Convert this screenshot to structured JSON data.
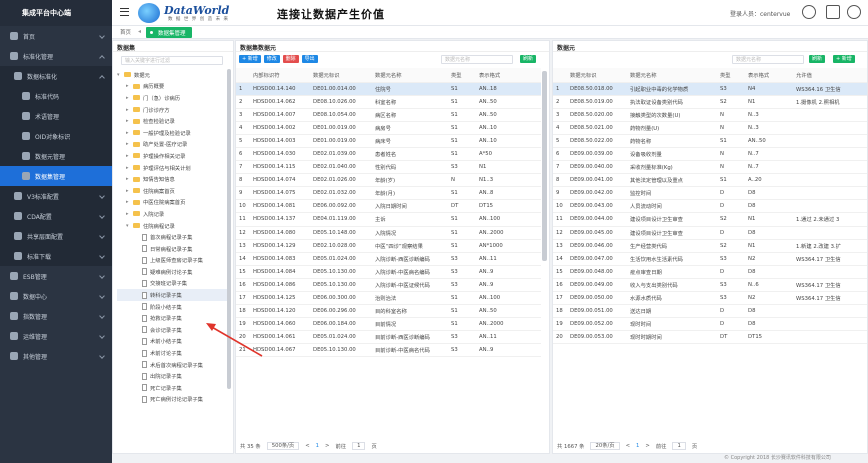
{
  "app": {
    "title": "集成平台中心端"
  },
  "sidebar": {
    "items": [
      {
        "label": "首页",
        "level": 0
      },
      {
        "label": "标准化管理",
        "level": 0,
        "open": true
      },
      {
        "label": "数据标准化",
        "level": 1,
        "open": true
      },
      {
        "label": "标准代码",
        "level": 2
      },
      {
        "label": "术语管理",
        "level": 2
      },
      {
        "label": "OID对象标识",
        "level": 2
      },
      {
        "label": "数据元管理",
        "level": 2
      },
      {
        "label": "数据集管理",
        "level": 2,
        "active": true
      },
      {
        "label": "V3标准配置",
        "level": 1
      },
      {
        "label": "CDA配置",
        "level": 1
      },
      {
        "label": "共享层面配置",
        "level": 1
      },
      {
        "label": "标准下载",
        "level": 1
      },
      {
        "label": "ESB管理",
        "level": 0
      },
      {
        "label": "数据中心",
        "level": 0
      },
      {
        "label": "指数管理",
        "level": 0
      },
      {
        "label": "运维管理",
        "level": 0
      },
      {
        "label": "其他管理",
        "level": 0
      }
    ]
  },
  "topbar": {
    "brand": "DataWorld",
    "brand_sub": "数 据 世 界 创 造 未 来",
    "slogan": "连接让数据产生价值",
    "login_text": "登录人员：centervue"
  },
  "tabs": {
    "home": "首页",
    "active": "数据集管理"
  },
  "tree": {
    "title": "数据集",
    "search_placeholder": "输入关键字进行过滤",
    "nodes": [
      {
        "label": "数据元",
        "type": "folder",
        "level": 0,
        "open": true
      },
      {
        "label": "病历概要",
        "type": "folder",
        "level": 1
      },
      {
        "label": "门（急）诊病历",
        "type": "folder",
        "level": 1
      },
      {
        "label": "门诊诊疗方",
        "type": "folder",
        "level": 1
      },
      {
        "label": "检查检验记录",
        "type": "folder",
        "level": 1
      },
      {
        "label": "一般护理及检验记录",
        "type": "folder",
        "level": 1
      },
      {
        "label": "助产处置-医疗记录",
        "type": "folder",
        "level": 1
      },
      {
        "label": "护理操作相关记录",
        "type": "folder",
        "level": 1
      },
      {
        "label": "护理评估与相关计划",
        "type": "folder",
        "level": 1
      },
      {
        "label": "知情告知信息",
        "type": "folder",
        "level": 1
      },
      {
        "label": "住院病案首页",
        "type": "folder",
        "level": 1
      },
      {
        "label": "中医住院病案首页",
        "type": "folder",
        "level": 1
      },
      {
        "label": "入院记录",
        "type": "folder",
        "level": 1
      },
      {
        "label": "住院病程记录",
        "type": "folder",
        "level": 1,
        "open": true
      },
      {
        "label": "首次病程记录子集",
        "type": "file",
        "level": 2
      },
      {
        "label": "日常病程记录子集",
        "type": "file",
        "level": 2
      },
      {
        "label": "上级医师查房记录子集",
        "type": "file",
        "level": 2
      },
      {
        "label": "疑难病例讨论子集",
        "type": "file",
        "level": 2
      },
      {
        "label": "交接班记录子集",
        "type": "file",
        "level": 2
      },
      {
        "label": "转科记录子集",
        "type": "file",
        "level": 2,
        "selected": true
      },
      {
        "label": "阶段小结子集",
        "type": "file",
        "level": 2
      },
      {
        "label": "抢救记录子集",
        "type": "file",
        "level": 2
      },
      {
        "label": "会诊记录子集",
        "type": "file",
        "level": 2
      },
      {
        "label": "术前小结子集",
        "type": "file",
        "level": 2
      },
      {
        "label": "术前讨论子集",
        "type": "file",
        "level": 2
      },
      {
        "label": "术后首次病程记录子集",
        "type": "file",
        "level": 2
      },
      {
        "label": "出院记录子集",
        "type": "file",
        "level": 2
      },
      {
        "label": "死亡记录子集",
        "type": "file",
        "level": 2
      },
      {
        "label": "死亡病例讨论记录子集",
        "type": "file",
        "level": 2
      }
    ]
  },
  "dataset_panel": {
    "title": "数据集数据元",
    "btn_add": "+ 新增",
    "btn_edit": "修改",
    "btn_delete": "删除",
    "btn_export": "导出",
    "search_placeholder": "数据元名称",
    "btn_refresh": "刷新",
    "columns": [
      "",
      "内部标识符",
      "数据元标识",
      "数据元名称",
      "类型",
      "表示格式"
    ],
    "rows": [
      [
        "1",
        "HDSD00.14.140",
        "DE01.00.014.00",
        "住院号",
        "S1",
        "AN..18"
      ],
      [
        "2",
        "HDSD00.14.062",
        "DE08.10.026.00",
        "科室名称",
        "S1",
        "AN..50"
      ],
      [
        "3",
        "HDSD00.14.007",
        "DE08.10.054.00",
        "病区名称",
        "S1",
        "AN..50"
      ],
      [
        "4",
        "HDSD00.14.002",
        "DE01.00.019.00",
        "病房号",
        "S1",
        "AN..10"
      ],
      [
        "5",
        "HDSD00.14.003",
        "DE01.00.019.00",
        "病床号",
        "S1",
        "AN..10"
      ],
      [
        "6",
        "HDSD00.14.030",
        "DE02.01.039.00",
        "患者姓名",
        "S1",
        "A*50"
      ],
      [
        "7",
        "HDSD00.14.115",
        "DE02.01.040.00",
        "性别代码",
        "S3",
        "N1"
      ],
      [
        "8",
        "HDSD00.14.074",
        "DE02.01.026.00",
        "年龄(岁)",
        "N",
        "N1..3"
      ],
      [
        "9",
        "HDSD00.14.075",
        "DE02.01.032.00",
        "年龄(月)",
        "S1",
        "AN..8"
      ],
      [
        "10",
        "HDSD00.14.081",
        "DE06.00.092.00",
        "入院日期时间",
        "DT",
        "DT15"
      ],
      [
        "11",
        "HDSD00.14.137",
        "DE04.01.119.00",
        "主诉",
        "S1",
        "AN..100"
      ],
      [
        "12",
        "HDSD00.14.080",
        "DE05.10.148.00",
        "入院情况",
        "S1",
        "AN..2000"
      ],
      [
        "13",
        "HDSD00.14.129",
        "DE02.10.028.00",
        "中医“四诊”观察结果",
        "S1",
        "AN*1000"
      ],
      [
        "14",
        "HDSD00.14.083",
        "DE05.01.024.00",
        "入院诊断-西医诊断编码",
        "S3",
        "AN..11"
      ],
      [
        "15",
        "HDSD00.14.084",
        "DE05.10.130.00",
        "入院诊断-中医病名编码",
        "S3",
        "AN..9"
      ],
      [
        "16",
        "HDSD00.14.086",
        "DE05.10.130.00",
        "入院诊断-中医证候代码",
        "S3",
        "AN..9"
      ],
      [
        "17",
        "HDSD00.14.125",
        "DE06.00.300.00",
        "治则治法",
        "S1",
        "AN..100"
      ],
      [
        "18",
        "HDSD00.14.120",
        "DE06.00.296.00",
        "目的科室名称",
        "S1",
        "AN..50"
      ],
      [
        "19",
        "HDSD00.14.060",
        "DE06.00.184.00",
        "目前情况",
        "S1",
        "AN..2000"
      ],
      [
        "20",
        "HDSD00.14.061",
        "DE05.01.024.00",
        "目前诊断-西医诊断编码",
        "S3",
        "AN..11"
      ],
      [
        "21",
        "HDSD00.14.067",
        "DE05.10.130.00",
        "目前诊断-中医病名代码",
        "S3",
        "AN..9"
      ]
    ],
    "pager": {
      "total": "共 35 条",
      "size": "500条/页",
      "prev": "<",
      "page": "1",
      "next": ">",
      "goto": "前往",
      "page_input": "1",
      "unit": "页"
    }
  },
  "element_panel": {
    "title": "数据元",
    "search_placeholder": "数据元名称",
    "btn_refresh": "刷新",
    "btn_add": "+ 新增",
    "btn_refresh2": "刷新",
    "columns": [
      "",
      "数据元标识",
      "数据元名称",
      "类型",
      "表示格式",
      "允许值"
    ],
    "rows": [
      [
        "1",
        "DE08.50.018.00",
        "引起职业中毒的化学物质",
        "S3",
        "N4",
        "WS364.16 卫生信"
      ],
      [
        "2",
        "DE08.50.019.00",
        "执法取证设备类别代码",
        "S2",
        "N1",
        "1.摄像机 2.照相机"
      ],
      [
        "3",
        "DE08.50.020.00",
        "接触类型的次数量(U)",
        "N",
        "N..3",
        ""
      ],
      [
        "4",
        "DE08.50.021.00",
        "药物剂量(U)",
        "N",
        "N..3",
        ""
      ],
      [
        "5",
        "DE08.50.022.00",
        "药物名称",
        "S1",
        "AN..50",
        ""
      ],
      [
        "6",
        "DE09.00.039.00",
        "设备吸收剂量",
        "N",
        "N..7",
        ""
      ],
      [
        "7",
        "DE09.00.040.00",
        "采收剂量标准(Kg)",
        "N",
        "N..7",
        ""
      ],
      [
        "8",
        "DE09.00.041.00",
        "其他法定管理以及重点",
        "S1",
        "A..20",
        ""
      ],
      [
        "9",
        "DE09.00.042.00",
        "监控时间",
        "D",
        "D8",
        ""
      ],
      [
        "10",
        "DE09.00.043.00",
        "人员流动时间",
        "D",
        "D8",
        ""
      ],
      [
        "11",
        "DE09.00.044.00",
        "建设项目设计卫生审查",
        "S2",
        "N1",
        "1.通过 2.未通过 3"
      ],
      [
        "12",
        "DE09.00.045.00",
        "建设项目设计卫生审查",
        "D",
        "D8",
        ""
      ],
      [
        "13",
        "DE09.00.046.00",
        "生产经营类代码",
        "S2",
        "N1",
        "1.新建 2.改建 3.扩"
      ],
      [
        "14",
        "DE09.00.047.00",
        "生活饮用水生活素代码",
        "S3",
        "N2",
        "WS364.17 卫生信"
      ],
      [
        "15",
        "DE09.00.048.00",
        "疫点审查日期",
        "D",
        "D8",
        ""
      ],
      [
        "16",
        "DE09.00.049.00",
        "收入与支出类别代码",
        "S3",
        "N..6",
        "WS364.17 卫生信"
      ],
      [
        "17",
        "DE09.00.050.00",
        "水源水质代码",
        "S3",
        "N2",
        "WS364.17 卫生信"
      ],
      [
        "18",
        "DE09.00.051.00",
        "送达日期",
        "D",
        "D8",
        ""
      ],
      [
        "19",
        "DE09.00.052.00",
        "现时时间",
        "D",
        "D8",
        ""
      ],
      [
        "20",
        "DE09.00.053.00",
        "现时时期时间",
        "DT",
        "DT15",
        ""
      ]
    ],
    "pager": {
      "total": "共 1667 条",
      "size": "20条/页",
      "prev": "<",
      "page": "1",
      "next": ">",
      "goto": "前往",
      "page_input": "1",
      "unit": "页"
    }
  },
  "footer": {
    "copyright": "© Copyright 2018 长沙赛讯软件科技有限公司"
  },
  "colors": {
    "sidebar": "#2b3442",
    "active": "#1e6fd9",
    "accent_green": "#18b566",
    "arrow": "#e0342b"
  }
}
